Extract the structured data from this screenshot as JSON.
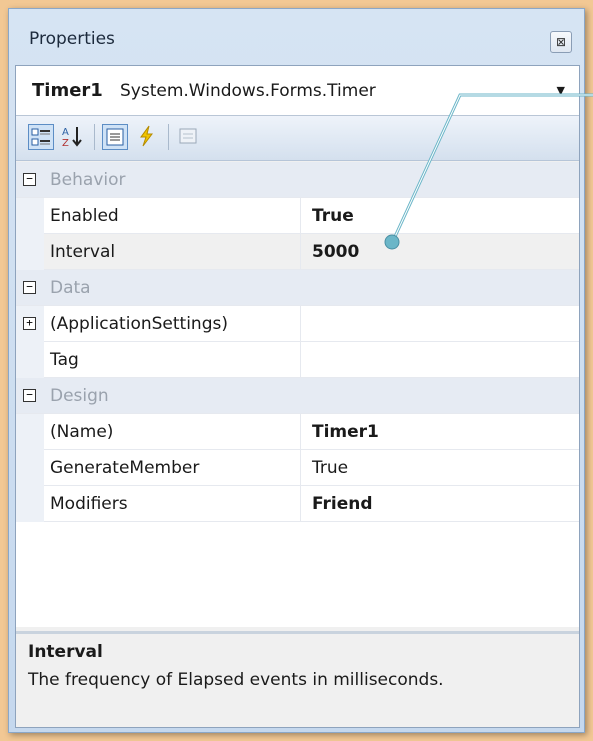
{
  "window": {
    "title": "Properties",
    "close_glyph": "⊠"
  },
  "selector": {
    "object_name": "Timer1",
    "object_type": "System.Windows.Forms.Timer",
    "dropdown_glyph": "▼"
  },
  "toolbar": {
    "buttons": [
      {
        "icon": "categorized-icon",
        "selected": true
      },
      {
        "icon": "alphabetical-icon",
        "selected": false
      },
      {
        "icon": "properties-icon",
        "selected": true
      },
      {
        "icon": "events-icon",
        "selected": false
      },
      {
        "icon": "property-pages-icon",
        "selected": false
      }
    ]
  },
  "grid": {
    "rows": [
      {
        "type": "category",
        "label": "Behavior",
        "toggle": "−"
      },
      {
        "type": "property",
        "label": "Enabled",
        "value": "True",
        "bold": true
      },
      {
        "type": "property",
        "label": "Interval",
        "value": "5000",
        "bold": true
      },
      {
        "type": "category",
        "label": "Data",
        "toggle": "−"
      },
      {
        "type": "property",
        "label": "(ApplicationSettings)",
        "value": "",
        "toggle": "+"
      },
      {
        "type": "property",
        "label": "Tag",
        "value": ""
      },
      {
        "type": "category",
        "label": "Design",
        "toggle": "−"
      },
      {
        "type": "property",
        "label": "(Name)",
        "value": "Timer1",
        "bold": true
      },
      {
        "type": "property",
        "label": "GenerateMember",
        "value": "True",
        "bold": false
      },
      {
        "type": "property",
        "label": "Modifiers",
        "value": "Friend",
        "bold": true
      }
    ]
  },
  "description": {
    "title": "Interval",
    "text": "The frequency of Elapsed events in milliseconds."
  },
  "colors": {
    "background": "#f2c894",
    "callout": "#6bb6c8",
    "category_row": "#e6ebf3"
  }
}
